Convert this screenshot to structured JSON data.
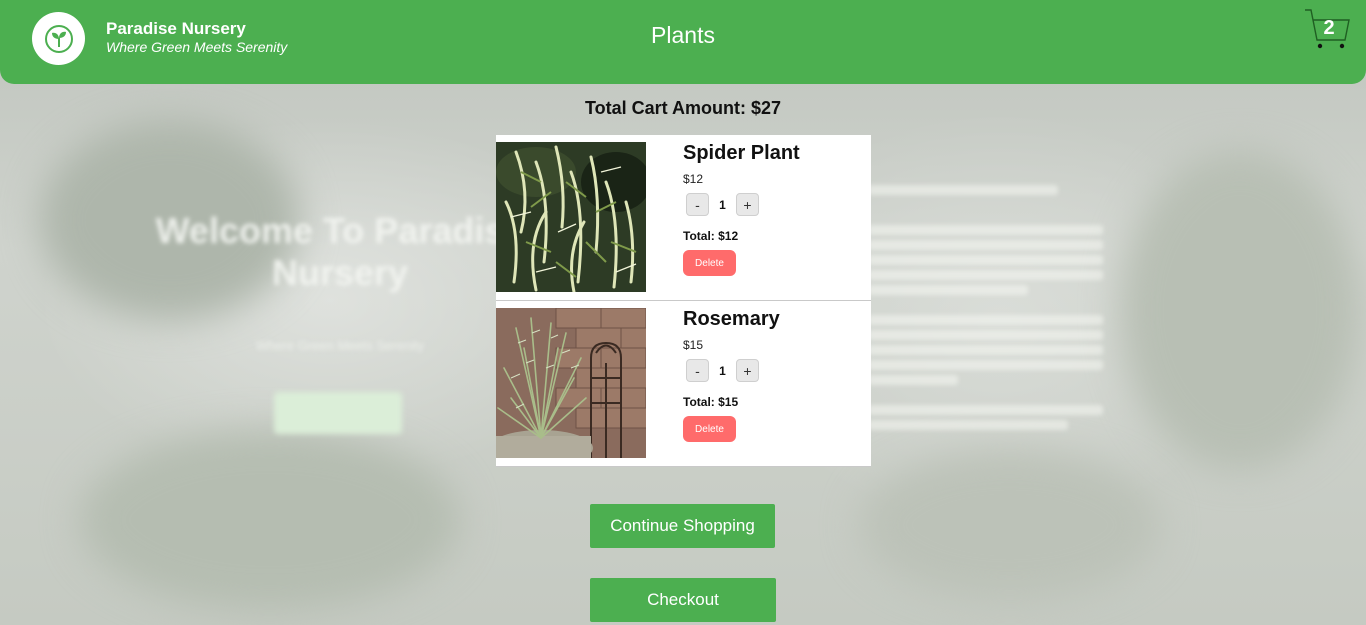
{
  "header": {
    "brand_name": "Paradise Nursery",
    "tagline": "Where Green Meets Serenity",
    "nav_title": "Plants",
    "cart_count": "2"
  },
  "background": {
    "welcome": "Welcome To Paradise Nursery",
    "subtitle": "Where Green Meets Serenity",
    "get_started": "Get Started"
  },
  "cart": {
    "total_amount": "Total Cart Amount: $27",
    "items": [
      {
        "name": "Spider Plant",
        "price": "$12",
        "minus": "-",
        "quantity": "1",
        "plus": "+",
        "total": "Total: $12",
        "delete": "Delete"
      },
      {
        "name": "Rosemary",
        "price": "$15",
        "minus": "-",
        "quantity": "1",
        "plus": "+",
        "total": "Total: $15",
        "delete": "Delete"
      }
    ],
    "continue_shopping": "Continue Shopping",
    "checkout": "Checkout"
  },
  "colors": {
    "header_green": "#4caf50",
    "delete_red": "#ff6b6b",
    "button_green": "#4caf50"
  },
  "icons": {
    "logo": "sprout-icon",
    "cart": "cart-icon"
  }
}
